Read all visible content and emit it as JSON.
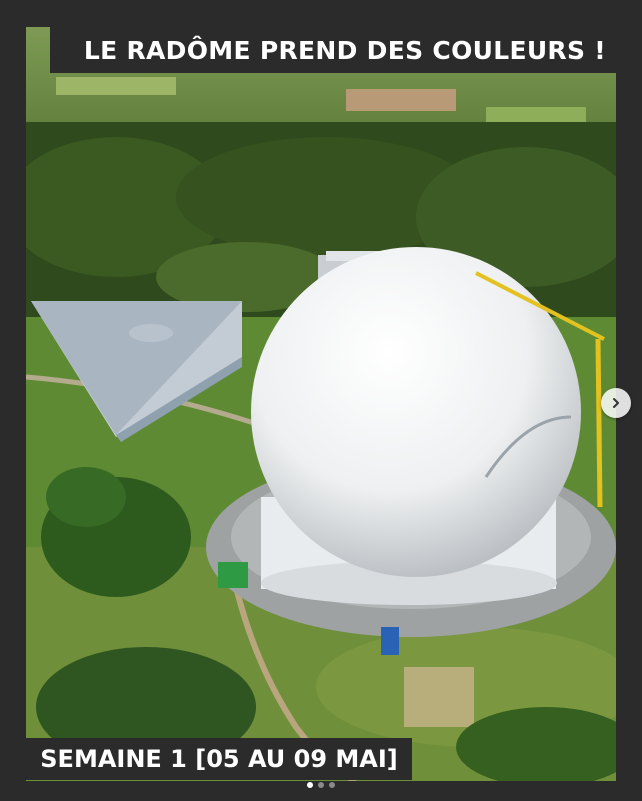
{
  "post": {
    "title": "LE RADÔME PREND DES COULEURS !",
    "week_label": "SEMAINE 1 [05 AU 09 MAI]"
  },
  "carousel": {
    "next_icon": "chevron-right-icon",
    "slide_count": 3,
    "active_slide": 1
  },
  "colors": {
    "background": "#2b2b2b",
    "text": "#ffffff"
  }
}
